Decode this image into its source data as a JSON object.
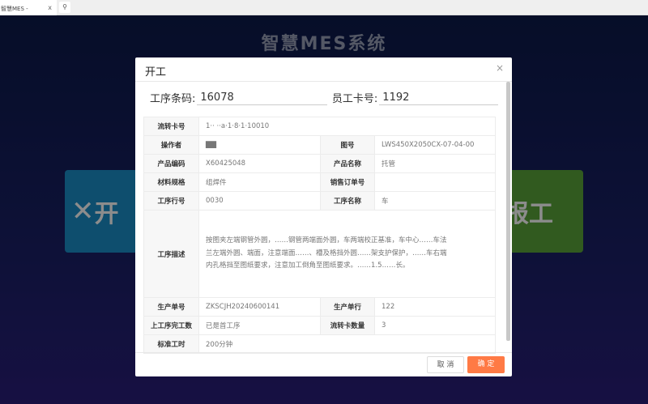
{
  "browser": {
    "tab_title": "智慧MES -",
    "tab_close": "x",
    "search_icon": "⚲"
  },
  "app": {
    "title": "智慧MES系统",
    "card_start": "开",
    "card_report": "报工"
  },
  "dialog": {
    "title": "开工",
    "close": "×",
    "barcode_label": "工序条码:",
    "barcode_value": "16078",
    "card_label": "员工卡号:",
    "card_value": "1192",
    "rows": {
      "flow_card_label": "流转卡号",
      "flow_card_value": "1·· ··a·1·8·1·10010",
      "operator_label": "操作者",
      "operator_value": "▇▇",
      "drawing_label": "图号",
      "drawing_value": "LWS450X2050CX-07-04-00",
      "product_code_label": "产品编码",
      "product_code_value": "X60425048",
      "product_name_label": "产品名称",
      "product_name_value": "托管",
      "material_label": "材料规格",
      "material_value": "组焊件",
      "sales_order_label": "销售订单号",
      "sales_order_value": "",
      "process_no_label": "工序行号",
      "process_no_value": "0030",
      "process_name_label": "工序名称",
      "process_name_value": "车",
      "desc_label": "工序描述",
      "desc_value": "按图夹左端钢管外圆，……钢管两端面外圆，车两端校正基准，车中心……车法兰左端外圆、端面，注意端面……、槽及格挡外圆……架支护保护，……车右端内孔格挡至图纸要求，注意加工倒角至图纸要求。……1.5……长。",
      "prod_order_label": "生产单号",
      "prod_order_value": "ZKSCJH20240600141",
      "prod_line_label": "生产单行",
      "prod_line_value": "122",
      "prev_done_label": "上工序完工数",
      "prev_done_value": "已是首工序",
      "flow_qty_label": "流转卡数量",
      "flow_qty_value": "3",
      "std_time_label": "标准工时",
      "std_time_value": "200分钟"
    },
    "cancel": "取 消",
    "ok": "确 定"
  }
}
